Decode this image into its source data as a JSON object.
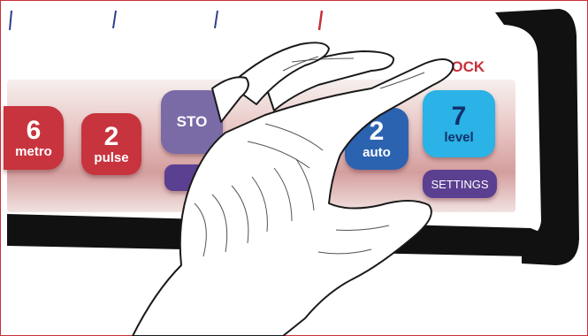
{
  "device": {
    "lock_label": "LOCK",
    "buttons": [
      {
        "id": "metro",
        "number": "6",
        "label": "metro",
        "color": "#c8343e"
      },
      {
        "id": "pulse",
        "number": "2",
        "label": "pulse",
        "color": "#c8343e"
      },
      {
        "id": "stop",
        "text": "STO",
        "color": "#7a6aa6"
      },
      {
        "id": "auto",
        "number": "2",
        "label": "auto",
        "color": "#2c63b0"
      },
      {
        "id": "level",
        "number": "7",
        "label": "level",
        "color": "#2bb2e6"
      }
    ],
    "settings_label": "SETTINGS"
  },
  "colors": {
    "accent_red": "#c8303a",
    "bezel": "#111111",
    "settings": "#5b3f91"
  },
  "illustration": {
    "subject": "hand-icon"
  }
}
